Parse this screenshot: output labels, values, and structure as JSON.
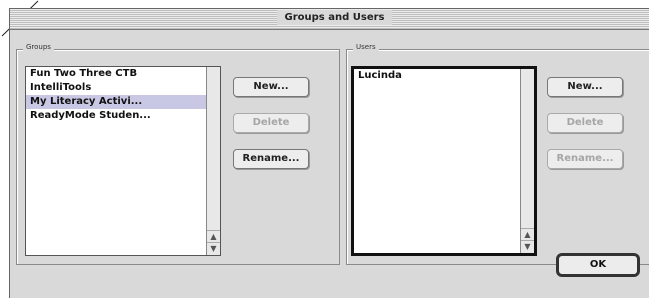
{
  "window": {
    "title": "Groups and Users"
  },
  "groups": {
    "label": "Groups",
    "items": [
      "Fun Two Three CTB",
      "IntelliTools",
      "My Literacy Activi...",
      "ReadyMode Studen..."
    ],
    "selected_index": 2,
    "buttons": {
      "new": "New...",
      "delete": "Delete",
      "rename": "Rename..."
    }
  },
  "users": {
    "label": "Users",
    "items": [
      "Lucinda"
    ],
    "buttons": {
      "new": "New...",
      "delete": "Delete",
      "rename": "Rename..."
    }
  },
  "ok_label": "OK",
  "scroll_up_icon": "▲",
  "scroll_down_icon": "▼"
}
